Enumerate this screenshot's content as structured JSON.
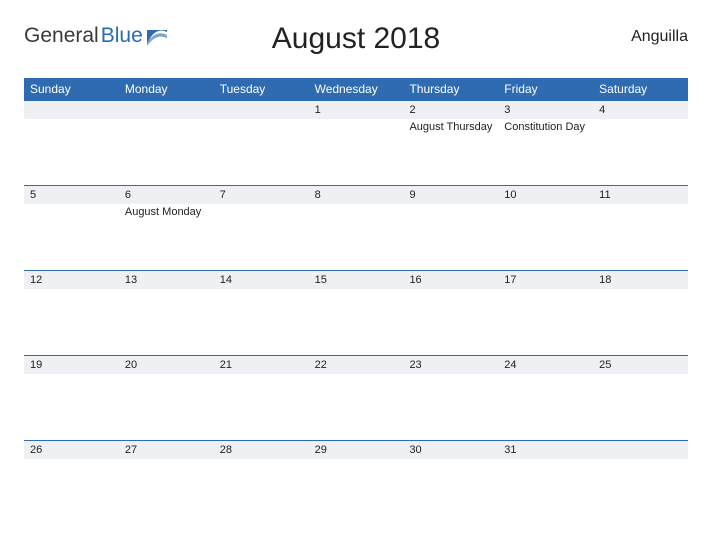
{
  "brand": {
    "word1": "General",
    "word2": "Blue"
  },
  "title": "August 2018",
  "region": "Anguilla",
  "dow": [
    "Sunday",
    "Monday",
    "Tuesday",
    "Wednesday",
    "Thursday",
    "Friday",
    "Saturday"
  ],
  "weeks": [
    [
      {
        "n": "",
        "e": ""
      },
      {
        "n": "",
        "e": ""
      },
      {
        "n": "",
        "e": ""
      },
      {
        "n": "1",
        "e": ""
      },
      {
        "n": "2",
        "e": "August Thursday"
      },
      {
        "n": "3",
        "e": "Constitution Day"
      },
      {
        "n": "4",
        "e": ""
      }
    ],
    [
      {
        "n": "5",
        "e": ""
      },
      {
        "n": "6",
        "e": "August Monday"
      },
      {
        "n": "7",
        "e": ""
      },
      {
        "n": "8",
        "e": ""
      },
      {
        "n": "9",
        "e": ""
      },
      {
        "n": "10",
        "e": ""
      },
      {
        "n": "11",
        "e": ""
      }
    ],
    [
      {
        "n": "12",
        "e": ""
      },
      {
        "n": "13",
        "e": ""
      },
      {
        "n": "14",
        "e": ""
      },
      {
        "n": "15",
        "e": ""
      },
      {
        "n": "16",
        "e": ""
      },
      {
        "n": "17",
        "e": ""
      },
      {
        "n": "18",
        "e": ""
      }
    ],
    [
      {
        "n": "19",
        "e": ""
      },
      {
        "n": "20",
        "e": ""
      },
      {
        "n": "21",
        "e": ""
      },
      {
        "n": "22",
        "e": ""
      },
      {
        "n": "23",
        "e": ""
      },
      {
        "n": "24",
        "e": ""
      },
      {
        "n": "25",
        "e": ""
      }
    ],
    [
      {
        "n": "26",
        "e": ""
      },
      {
        "n": "27",
        "e": ""
      },
      {
        "n": "28",
        "e": ""
      },
      {
        "n": "29",
        "e": ""
      },
      {
        "n": "30",
        "e": ""
      },
      {
        "n": "31",
        "e": ""
      },
      {
        "n": "",
        "e": ""
      }
    ]
  ]
}
